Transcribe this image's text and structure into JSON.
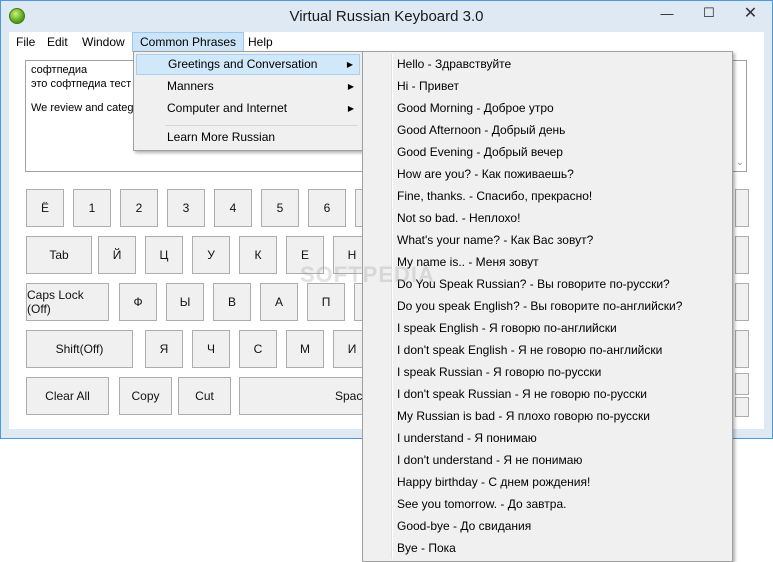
{
  "window": {
    "title": "Virtual Russian Keyboard 3.0",
    "controls": {
      "minimize": "—",
      "maximize": "☐",
      "close": "✕"
    },
    "icon": "green-orb-icon"
  },
  "menubar": [
    {
      "label": "File"
    },
    {
      "label": "Edit"
    },
    {
      "label": "Window"
    },
    {
      "label": "Common Phrases",
      "active": true
    },
    {
      "label": "Help"
    }
  ],
  "textbox": {
    "lines": [
      "софтпедиа",
      "это софтпедиа тест",
      "",
      "We review and categ"
    ]
  },
  "keyboard": {
    "row1": [
      "Ё",
      "1",
      "2",
      "3",
      "4",
      "5",
      "6",
      ""
    ],
    "row2": [
      "Tab",
      "Й",
      "Ц",
      "У",
      "К",
      "Е",
      "Н"
    ],
    "row3": [
      "Caps Lock (Off)",
      "Ф",
      "Ы",
      "В",
      "А",
      "П",
      ""
    ],
    "row4": [
      "Shift(Off)",
      "Я",
      "Ч",
      "С",
      "М",
      "И"
    ],
    "row5": [
      "Clear All",
      "Copy",
      "Cut",
      "Space"
    ]
  },
  "common_phrases_menu": {
    "items": [
      {
        "label": "Greetings and Conversation",
        "submenu": true,
        "active": true
      },
      {
        "label": "Manners",
        "submenu": true
      },
      {
        "label": "Computer and Internet",
        "submenu": true
      },
      {
        "label": "Learn More Russian",
        "submenu": false
      }
    ]
  },
  "greetings_submenu": {
    "items": [
      "Hello - Здравствуйте",
      "Hi - Привет",
      "Good Morning - Доброе утро",
      "Good Afternoon - Добрый день",
      "Good Evening - Добрый вечер",
      "How are you? - Как поживаешь?",
      "Fine, thanks. - Спасибо, прекрасно!",
      "Not so bad. - Неплохо!",
      "What's your name? - Как Вас зовут?",
      "My name is.. - Меня зовут",
      "Do You Speak Russian? - Вы говорите по-русски?",
      "Do you speak English? - Вы говорите по-английски?",
      "I speak English - Я говорю по-английски",
      "I don't speak English - Я не говорю по-английски",
      "I speak Russian - Я говорю по-русски",
      "I don't speak Russian - Я не говорю по-русски",
      "My Russian is bad - Я плохо говорю по-русски",
      "I understand - Я понимаю",
      "I don't understand - Я не понимаю",
      "Happy birthday - С днем рождения!",
      "See you tomorrow. - До завтра.",
      "Good-bye - До свидания",
      "Bye - Пока"
    ]
  },
  "watermark": "SOFTPEDIA"
}
